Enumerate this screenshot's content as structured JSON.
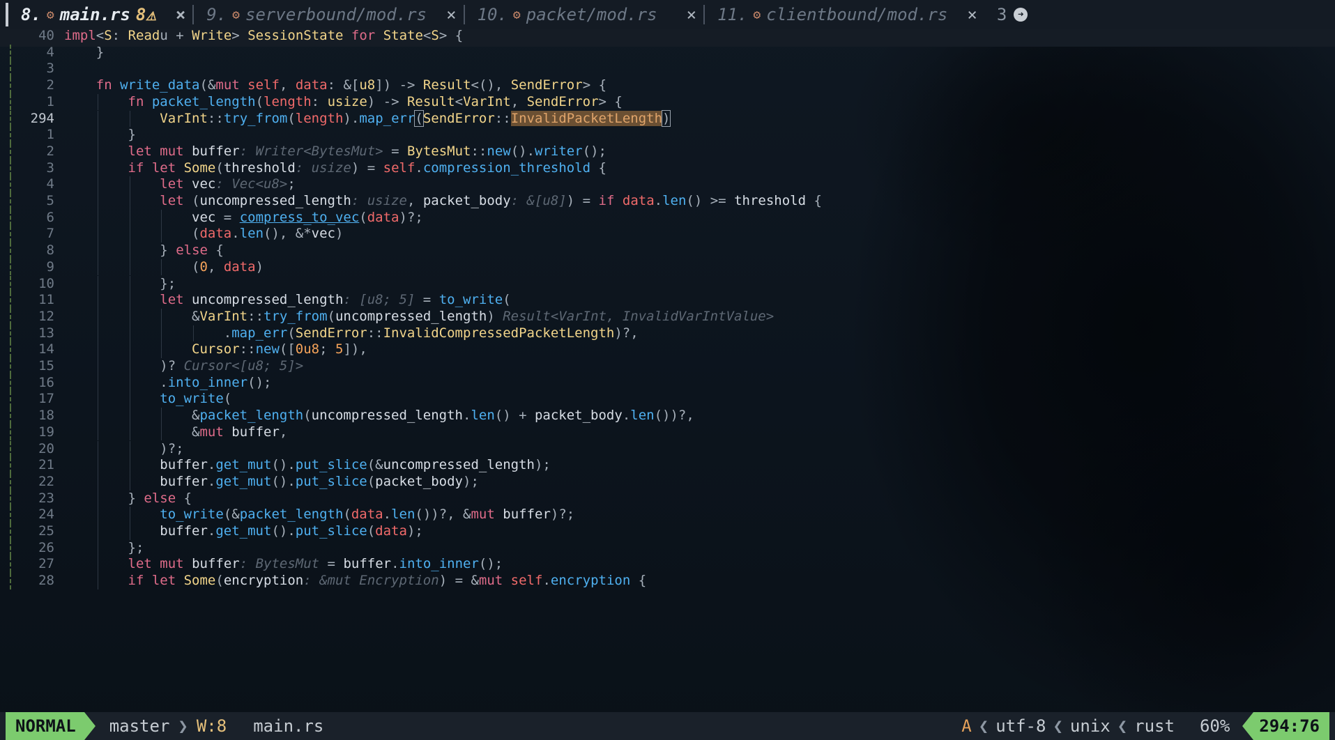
{
  "tabs": [
    {
      "num": "8.",
      "name": "main.rs",
      "warn": "8",
      "close": "×",
      "active": true
    },
    {
      "num": "9.",
      "name": "serverbound/mod.rs",
      "close": "×"
    },
    {
      "num": "10.",
      "name": "packet/mod.rs",
      "close": "×"
    },
    {
      "num": "11.",
      "name": "clientbound/mod.rs",
      "close": "×"
    }
  ],
  "more_count": "3",
  "lines": [
    {
      "n": "40",
      "code": "<span class=\"kw\">impl</span><span class=\"pn\">&lt;</span><span class=\"ty\">S</span><span class=\"pn\">: </span><span class=\"ty\">Read</span><span class=\"pn\">u + </span><span class=\"ty\">Write</span><span class=\"pn\">&gt; </span><span class=\"ty\">SessionState</span> <span class=\"kw\">for</span> <span class=\"ty\">State</span><span class=\"pn\">&lt;</span><span class=\"ty\">S</span><span class=\"pn\">&gt; {</span>",
      "sticky": true
    },
    {
      "n": "4",
      "code": "    <span class=\"pn\">}</span>"
    },
    {
      "n": "3",
      "code": ""
    },
    {
      "n": "2",
      "code": "    <span class=\"kw\">fn</span> <span class=\"fn\">write_data</span><span class=\"pn\">(&amp;</span><span class=\"kw\">mut</span> <span class=\"v\">self</span><span class=\"pn\">, </span><span class=\"v\">data</span><span class=\"pn\">: &amp;[</span><span class=\"ty\">u8</span><span class=\"pn\">]) -&gt; </span><span class=\"ty\">Result</span><span class=\"pn\">&lt;(), </span><span class=\"ty\">SendError</span><span class=\"pn\">&gt; {</span>"
    },
    {
      "n": "1",
      "code": "        <span class=\"kw\">fn</span> <span class=\"fn\">packet_length</span><span class=\"pn\">(</span><span class=\"v\">length</span><span class=\"pn\">: </span><span class=\"ty\">usize</span><span class=\"pn\">) -&gt; </span><span class=\"ty\">Result</span><span class=\"pn\">&lt;</span><span class=\"ty\">VarInt</span><span class=\"pn\">, </span><span class=\"ty\">SendError</span><span class=\"pn\">&gt; {</span>"
    },
    {
      "n": "294",
      "code": "            <span class=\"ty\">VarInt</span><span class=\"pn\">::</span><span class=\"fn\">try_from</span><span class=\"pn\">(</span><span class=\"v\">length</span><span class=\"pn\">).</span><span class=\"fn\">map_err</span><span class=\"pn curs\">(</span><span class=\"ty\">SendError</span><span class=\"pn\">::</span><span class=\"sel\">InvalidPacketLength</span><span class=\"pn curs\">)</span>",
      "current": true
    },
    {
      "n": "1",
      "code": "        <span class=\"pn\">}</span>"
    },
    {
      "n": "2",
      "code": "        <span class=\"kw\">let</span> <span class=\"kw\">mut</span> buffer<span class=\"hint\">: Writer&lt;BytesMut&gt;</span> <span class=\"pn\">=</span> <span class=\"ty\">BytesMut</span><span class=\"pn\">::</span><span class=\"fn\">new</span><span class=\"pn\">().</span><span class=\"fn\">writer</span><span class=\"pn\">();</span>"
    },
    {
      "n": "3",
      "code": "        <span class=\"kw\">if let</span> <span class=\"ty\">Some</span><span class=\"pn\">(</span>threshold<span class=\"hint\">: usize</span><span class=\"pn\">) =</span> <span class=\"v\">self</span><span class=\"pn\">.</span><span class=\"fn\">compression_threshold</span> <span class=\"pn\">{</span>"
    },
    {
      "n": "4",
      "code": "            <span class=\"kw\">let</span> vec<span class=\"hint\">: Vec&lt;u8&gt;</span><span class=\"pn\">;</span>"
    },
    {
      "n": "5",
      "code": "            <span class=\"kw\">let</span> <span class=\"pn\">(</span>uncompressed_length<span class=\"hint\">: usize</span><span class=\"pn\">,</span> packet_body<span class=\"hint\">: &amp;[u8]</span><span class=\"pn\">) =</span> <span class=\"kw\">if</span> <span class=\"v\">data</span><span class=\"pn\">.</span><span class=\"fn\">len</span><span class=\"pn\">() &gt;=</span> threshold <span class=\"pn\">{</span>"
    },
    {
      "n": "6",
      "code": "                vec <span class=\"pn\">=</span> <span class=\"fn ul\">compress_to_vec</span><span class=\"pn\">(</span><span class=\"v\">data</span><span class=\"pn\">)?;</span>"
    },
    {
      "n": "7",
      "code": "                <span class=\"pn\">(</span><span class=\"v\">data</span><span class=\"pn\">.</span><span class=\"fn\">len</span><span class=\"pn\">(), &amp;*</span>vec<span class=\"pn\">)</span>"
    },
    {
      "n": "8",
      "code": "            <span class=\"pn\">}</span> <span class=\"kw\">else</span> <span class=\"pn\">{</span>"
    },
    {
      "n": "9",
      "code": "                <span class=\"pn\">(</span><span class=\"nm\">0</span><span class=\"pn\">, </span><span class=\"v\">data</span><span class=\"pn\">)</span>"
    },
    {
      "n": "10",
      "code": "            <span class=\"pn\">};</span>"
    },
    {
      "n": "11",
      "code": "            <span class=\"kw\">let</span> uncompressed_length<span class=\"hint\">: [u8; 5]</span> <span class=\"pn\">=</span> <span class=\"fn\">to_write</span><span class=\"pn\">(</span>"
    },
    {
      "n": "12",
      "code": "                <span class=\"pn\">&amp;</span><span class=\"ty\">VarInt</span><span class=\"pn\">::</span><span class=\"fn\">try_from</span><span class=\"pn\">(</span>uncompressed_length<span class=\"pn\">)</span> <span class=\"hint\">Result&lt;VarInt, InvalidVarIntValue&gt;</span>"
    },
    {
      "n": "13",
      "code": "                    <span class=\"pn\">.</span><span class=\"fn\">map_err</span><span class=\"pn\">(</span><span class=\"ty\">SendError</span><span class=\"pn\">::</span><span class=\"ty\">InvalidCompressedPacketLength</span><span class=\"pn\">)?,</span>"
    },
    {
      "n": "14",
      "code": "                <span class=\"ty\">Cursor</span><span class=\"pn\">::</span><span class=\"fn\">new</span><span class=\"pn\">([</span><span class=\"nm\">0u8</span><span class=\"pn\">; </span><span class=\"nm\">5</span><span class=\"pn\">]),</span>"
    },
    {
      "n": "15",
      "code": "            <span class=\"pn\">)?</span> <span class=\"hint\">Cursor&lt;[u8; 5]&gt;</span>"
    },
    {
      "n": "16",
      "code": "            <span class=\"pn\">.</span><span class=\"fn\">into_inner</span><span class=\"pn\">();</span>"
    },
    {
      "n": "17",
      "code": "            <span class=\"fn\">to_write</span><span class=\"pn\">(</span>"
    },
    {
      "n": "18",
      "code": "                <span class=\"pn\">&amp;</span><span class=\"fn\">packet_length</span><span class=\"pn\">(</span>uncompressed_length<span class=\"pn\">.</span><span class=\"fn\">len</span><span class=\"pn\">() +</span> packet_body<span class=\"pn\">.</span><span class=\"fn\">len</span><span class=\"pn\">())?,</span>"
    },
    {
      "n": "19",
      "code": "                <span class=\"pn\">&amp;</span><span class=\"kw\">mut</span> buffer<span class=\"pn\">,</span>"
    },
    {
      "n": "20",
      "code": "            <span class=\"pn\">)?;</span>"
    },
    {
      "n": "21",
      "code": "            buffer<span class=\"pn\">.</span><span class=\"fn\">get_mut</span><span class=\"pn\">().</span><span class=\"fn\">put_slice</span><span class=\"pn\">(&amp;</span>uncompressed_length<span class=\"pn\">);</span>"
    },
    {
      "n": "22",
      "code": "            buffer<span class=\"pn\">.</span><span class=\"fn\">get_mut</span><span class=\"pn\">().</span><span class=\"fn\">put_slice</span><span class=\"pn\">(</span>packet_body<span class=\"pn\">);</span>"
    },
    {
      "n": "23",
      "code": "        <span class=\"pn\">}</span> <span class=\"kw\">else</span> <span class=\"pn\">{</span>"
    },
    {
      "n": "24",
      "code": "            <span class=\"fn\">to_write</span><span class=\"pn\">(&amp;</span><span class=\"fn\">packet_length</span><span class=\"pn\">(</span><span class=\"v\">data</span><span class=\"pn\">.</span><span class=\"fn\">len</span><span class=\"pn\">())?, &amp;</span><span class=\"kw\">mut</span> buffer<span class=\"pn\">)?;</span>"
    },
    {
      "n": "25",
      "code": "            buffer<span class=\"pn\">.</span><span class=\"fn\">get_mut</span><span class=\"pn\">().</span><span class=\"fn\">put_slice</span><span class=\"pn\">(</span><span class=\"v\">data</span><span class=\"pn\">);</span>"
    },
    {
      "n": "26",
      "code": "        <span class=\"pn\">};</span>"
    },
    {
      "n": "27",
      "code": "        <span class=\"kw\">let</span> <span class=\"kw\">mut</span> buffer<span class=\"hint\">: BytesMut</span> <span class=\"pn\">=</span> buffer<span class=\"pn\">.</span><span class=\"fn\">into_inner</span><span class=\"pn\">();</span>"
    },
    {
      "n": "28",
      "code": "        <span class=\"kw\">if let</span> <span class=\"ty\">Some</span><span class=\"pn\">(</span>encryption<span class=\"hint\">: &amp;mut Encryption</span><span class=\"pn\">) = &amp;</span><span class=\"kw\">mut</span> <span class=\"v\">self</span><span class=\"pn\">.</span><span class=\"fn\">encryption</span> <span class=\"pn\">{</span>"
    }
  ],
  "status": {
    "mode": "NORMAL",
    "branch": "master",
    "warnings": "W:8",
    "file": "main.rs",
    "flag": "A",
    "encoding": "utf-8",
    "format": "unix",
    "filetype": "rust",
    "percent": "60%",
    "position": "294:76"
  },
  "colors": {
    "mode_bg": "#7ccb6e",
    "keyword": "#e06c8a",
    "function": "#4fb0f0",
    "type": "#f2d58a"
  }
}
